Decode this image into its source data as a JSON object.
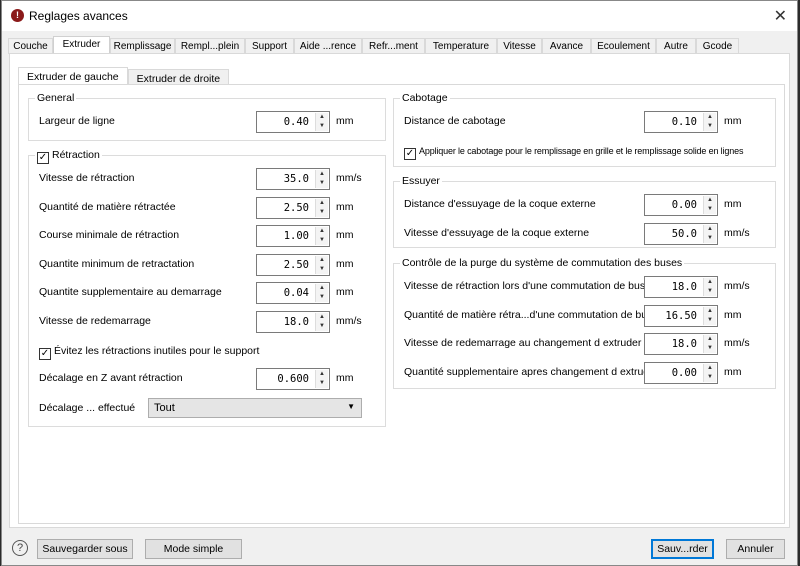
{
  "window": {
    "title": "Reglages avances"
  },
  "tabs": [
    "Couche",
    "Extruder",
    "Remplissage",
    "Rempl...plein",
    "Support",
    "Aide ...rence",
    "Refr...ment",
    "Temperature",
    "Vitesse",
    "Avance",
    "Ecoulement",
    "Autre",
    "Gcode"
  ],
  "inner_tabs": [
    "Extruder de gauche",
    "Extruder de droite"
  ],
  "general": {
    "title": "General",
    "rows": [
      {
        "label": "Largeur de ligne",
        "value": "0.40",
        "unit": "mm"
      }
    ]
  },
  "retraction": {
    "title": "Rétraction",
    "checked": true,
    "rows": [
      {
        "label": "Vitesse de rétraction",
        "value": "35.0",
        "unit": "mm/s"
      },
      {
        "label": "Quantité de matière rétractée",
        "value": "2.50",
        "unit": "mm"
      },
      {
        "label": "Course minimale de rétraction",
        "value": "1.00",
        "unit": "mm"
      },
      {
        "label": "Quantite minimum de retractation",
        "value": "2.50",
        "unit": "mm"
      },
      {
        "label": "Quantite supplementaire au demarrage",
        "value": "0.04",
        "unit": "mm"
      },
      {
        "label": "Vitesse de redemarrage",
        "value": "18.0",
        "unit": "mm/s"
      }
    ],
    "avoid_label": "Évitez les rétractions inutiles pour le support",
    "avoid_checked": true,
    "zhop": {
      "label": "Décalage en Z avant rétraction",
      "value": "0.600",
      "unit": "mm"
    },
    "zhop_when": {
      "label": "Décalage ... effectué",
      "value": "Tout"
    }
  },
  "cabotage": {
    "title": "Cabotage",
    "rows": [
      {
        "label": "Distance de cabotage",
        "value": "0.10",
        "unit": "mm"
      }
    ],
    "check_label": "Appliquer le cabotage pour le remplissage en grille et le remplissage solide en lignes",
    "checked": true
  },
  "essuyer": {
    "title": "Essuyer",
    "rows": [
      {
        "label": "Distance d'essuyage de la coque externe",
        "value": "0.00",
        "unit": "mm"
      },
      {
        "label": "Vitesse d'essuyage de la coque externe",
        "value": "50.0",
        "unit": "mm/s"
      }
    ]
  },
  "purge": {
    "title": "Contrôle de la purge du système de commutation des buses",
    "rows": [
      {
        "label": "Vitesse de rétraction lors d'une commutation de buse",
        "value": "18.0",
        "unit": "mm/s"
      },
      {
        "label": "Quantité de matière rétra...d'une commutation de buse",
        "value": "16.50",
        "unit": "mm"
      },
      {
        "label": "Vitesse de redemarrage au changement d extruder",
        "value": "18.0",
        "unit": "mm/s"
      },
      {
        "label": "Quantité supplementaire apres changement d extruder",
        "value": "0.00",
        "unit": "mm"
      }
    ]
  },
  "footer": {
    "help": "?",
    "save_as": "Sauvegarder sous",
    "simple": "Mode simple",
    "save": "Sauv...rder",
    "cancel": "Annuler"
  }
}
